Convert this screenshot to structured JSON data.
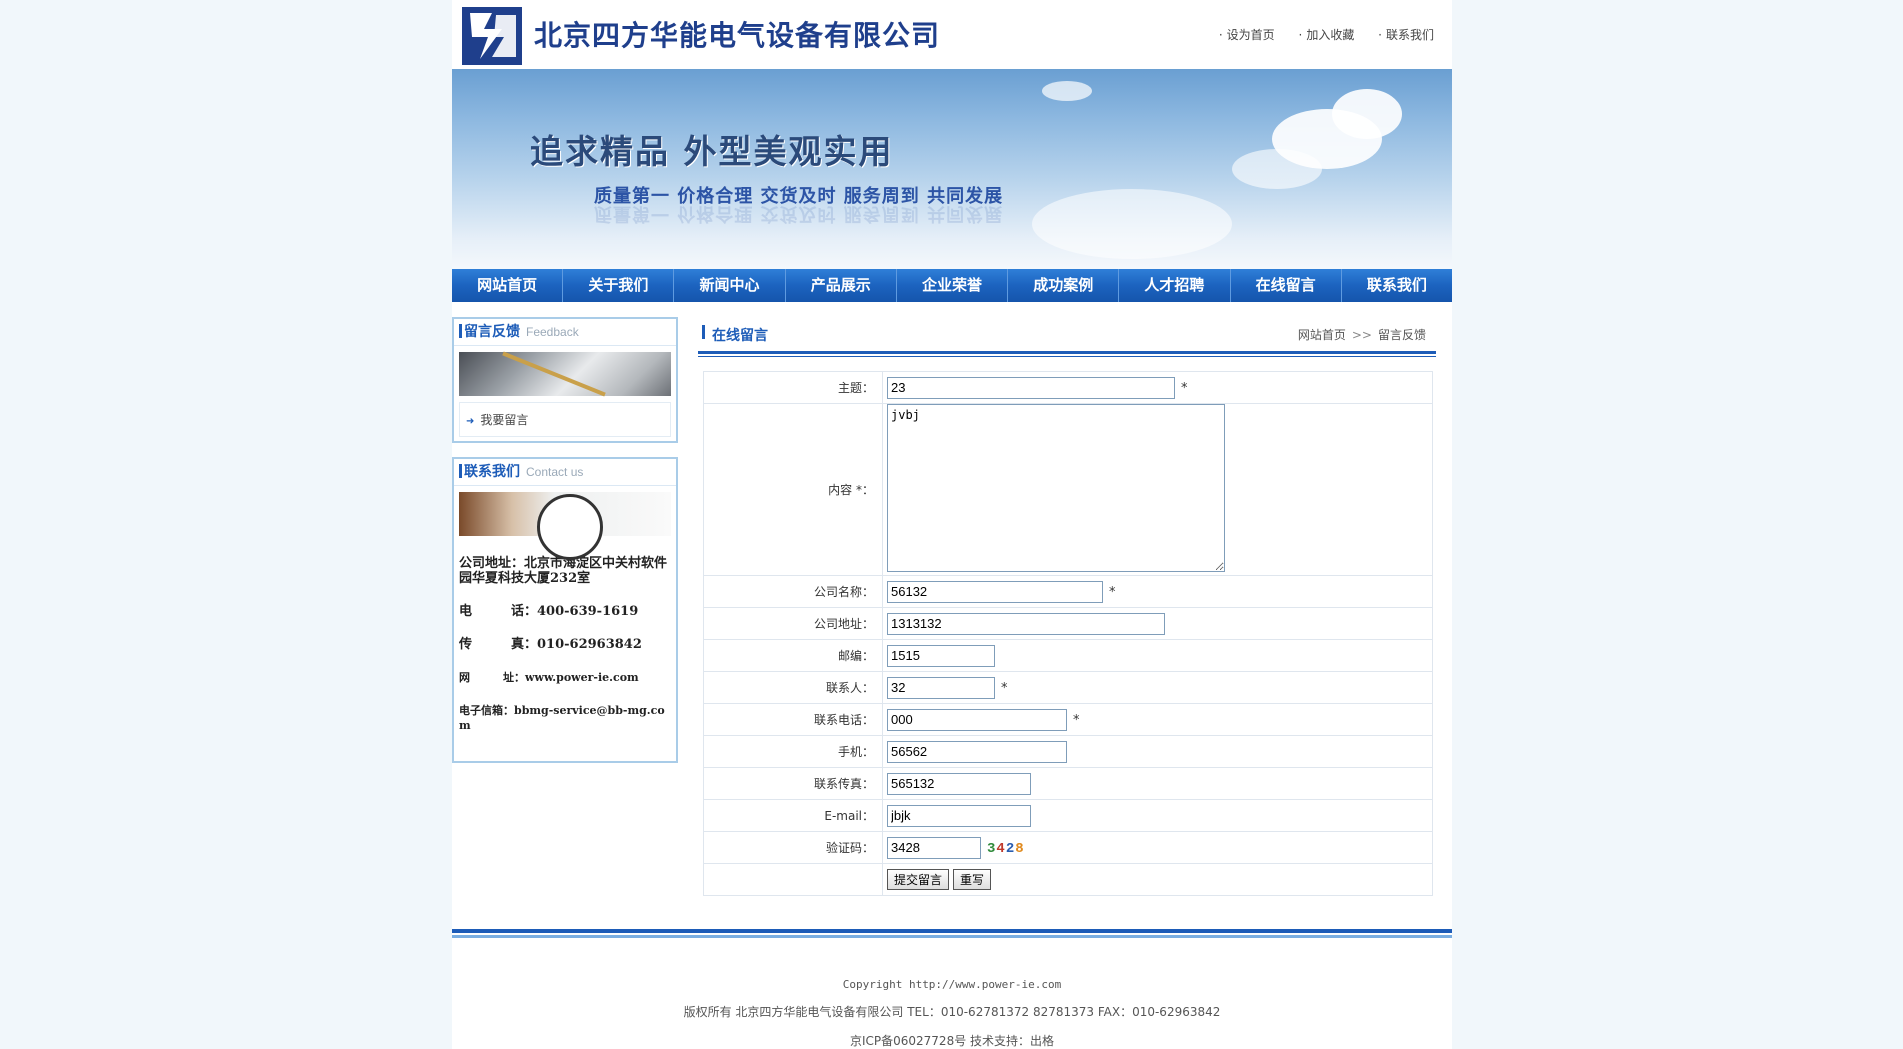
{
  "header": {
    "company_name": "北京四方华能电气设备有限公司",
    "links": [
      "设为首页",
      "加入收藏",
      "联系我们"
    ]
  },
  "banner": {
    "slogan_main": "追求精品  外型美观实用",
    "slogan_sub": "质量第一 价格合理 交货及时 服务周到 共同发展"
  },
  "nav": [
    "网站首页",
    "关于我们",
    "新闻中心",
    "产品展示",
    "企业荣誉",
    "成功案例",
    "人才招聘",
    "在线留言",
    "联系我们"
  ],
  "sidebar": {
    "feedback": {
      "title": "留言反馈",
      "title_en": "Feedback",
      "link": "我要留言"
    },
    "contact": {
      "title": "联系我们",
      "title_en": "Contact us",
      "address": "公司地址：北京市海淀区中关村软件园华夏科技大厦232室",
      "phone": "电　　　话：400-639-1619",
      "fax": "传　　　真：010-62963842",
      "web": "网　　　址：www.power-ie.com",
      "email": "电子信箱：bbmg-service@bb-mg.com"
    }
  },
  "main": {
    "title": "在线留言",
    "breadcrumb": {
      "home": "网站首页",
      "sep": ">>",
      "current": "留言反馈"
    },
    "form": {
      "subject": {
        "label": "主题：",
        "value": "23"
      },
      "content": {
        "label": "内容 *：",
        "value": "jvbj"
      },
      "company": {
        "label": "公司名称：",
        "value": "56132"
      },
      "address": {
        "label": "公司地址：",
        "value": "1313132"
      },
      "zip": {
        "label": "邮编：",
        "value": "1515"
      },
      "contact": {
        "label": "联系人：",
        "value": "32"
      },
      "phone": {
        "label": "联系电话：",
        "value": "000"
      },
      "mobile": {
        "label": "手机：",
        "value": "56562"
      },
      "fax": {
        "label": "联系传真：",
        "value": "565132"
      },
      "email": {
        "label": "E-mail：",
        "value": "jbjk"
      },
      "captcha": {
        "label": "验证码：",
        "value": "3428",
        "image_text": "3428"
      },
      "required_mark": "*",
      "submit_label": "提交留言",
      "reset_label": "重写"
    }
  },
  "footer": {
    "copyright": "Copyright http://www.power-ie.com",
    "rights": "版权所有 北京四方华能电气设备有限公司  TEL：010-62781372 82781373 FAX：010-62963842",
    "icp": "京ICP备06027728号 技术支持：出格"
  },
  "colors": {
    "brand_blue": "#1d5cb8",
    "nav_blue": "#1c63bf",
    "page_bg": "#f1f7fb"
  }
}
